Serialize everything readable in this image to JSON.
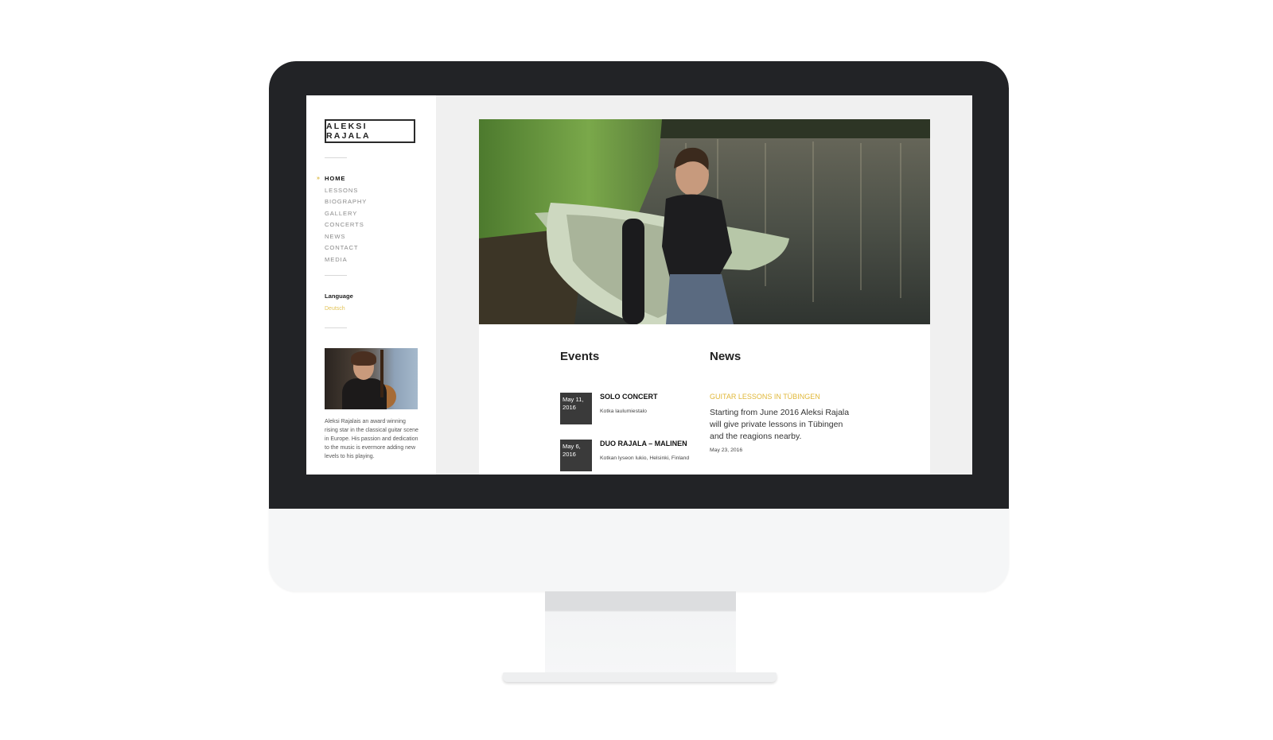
{
  "site": {
    "logo": "ALEKSI RAJALA"
  },
  "nav": {
    "items": [
      {
        "label": "HOME",
        "active": true
      },
      {
        "label": "LESSONS"
      },
      {
        "label": "BIOGRAPHY"
      },
      {
        "label": "GALLERY"
      },
      {
        "label": "CONCERTS"
      },
      {
        "label": "NEWS"
      },
      {
        "label": "CONTACT"
      },
      {
        "label": "MEDIA"
      }
    ],
    "active_marker": "»"
  },
  "language": {
    "title": "Language",
    "option": "Deutsch"
  },
  "bio": "Aleksi Rajalais an award winning rising star in the classical guitar scene in Europe. His passion and dedication to the music is evermore adding new levels to his playing.",
  "events": {
    "heading": "Events",
    "items": [
      {
        "date": "May 11, 2016",
        "title": "SOLO CONCERT",
        "venue": "Kotka laulumiestalo"
      },
      {
        "date": "May 6, 2016",
        "title": "DUO RAJALA – MALINEN",
        "venue": "Kotkan lyseon lukio, Helsinki, Finland"
      }
    ]
  },
  "news": {
    "heading": "News",
    "items": [
      {
        "title": "GUITAR LESSONS IN TÜBINGEN",
        "text": "Starting from June 2016 Aleksi Rajala will give private lessons in Tübingen and the reagions nearby.",
        "date": "May 23, 2016"
      }
    ]
  },
  "colors": {
    "accent": "#e0b738",
    "bezel": "#222326",
    "date_box": "#3a3a3a"
  }
}
